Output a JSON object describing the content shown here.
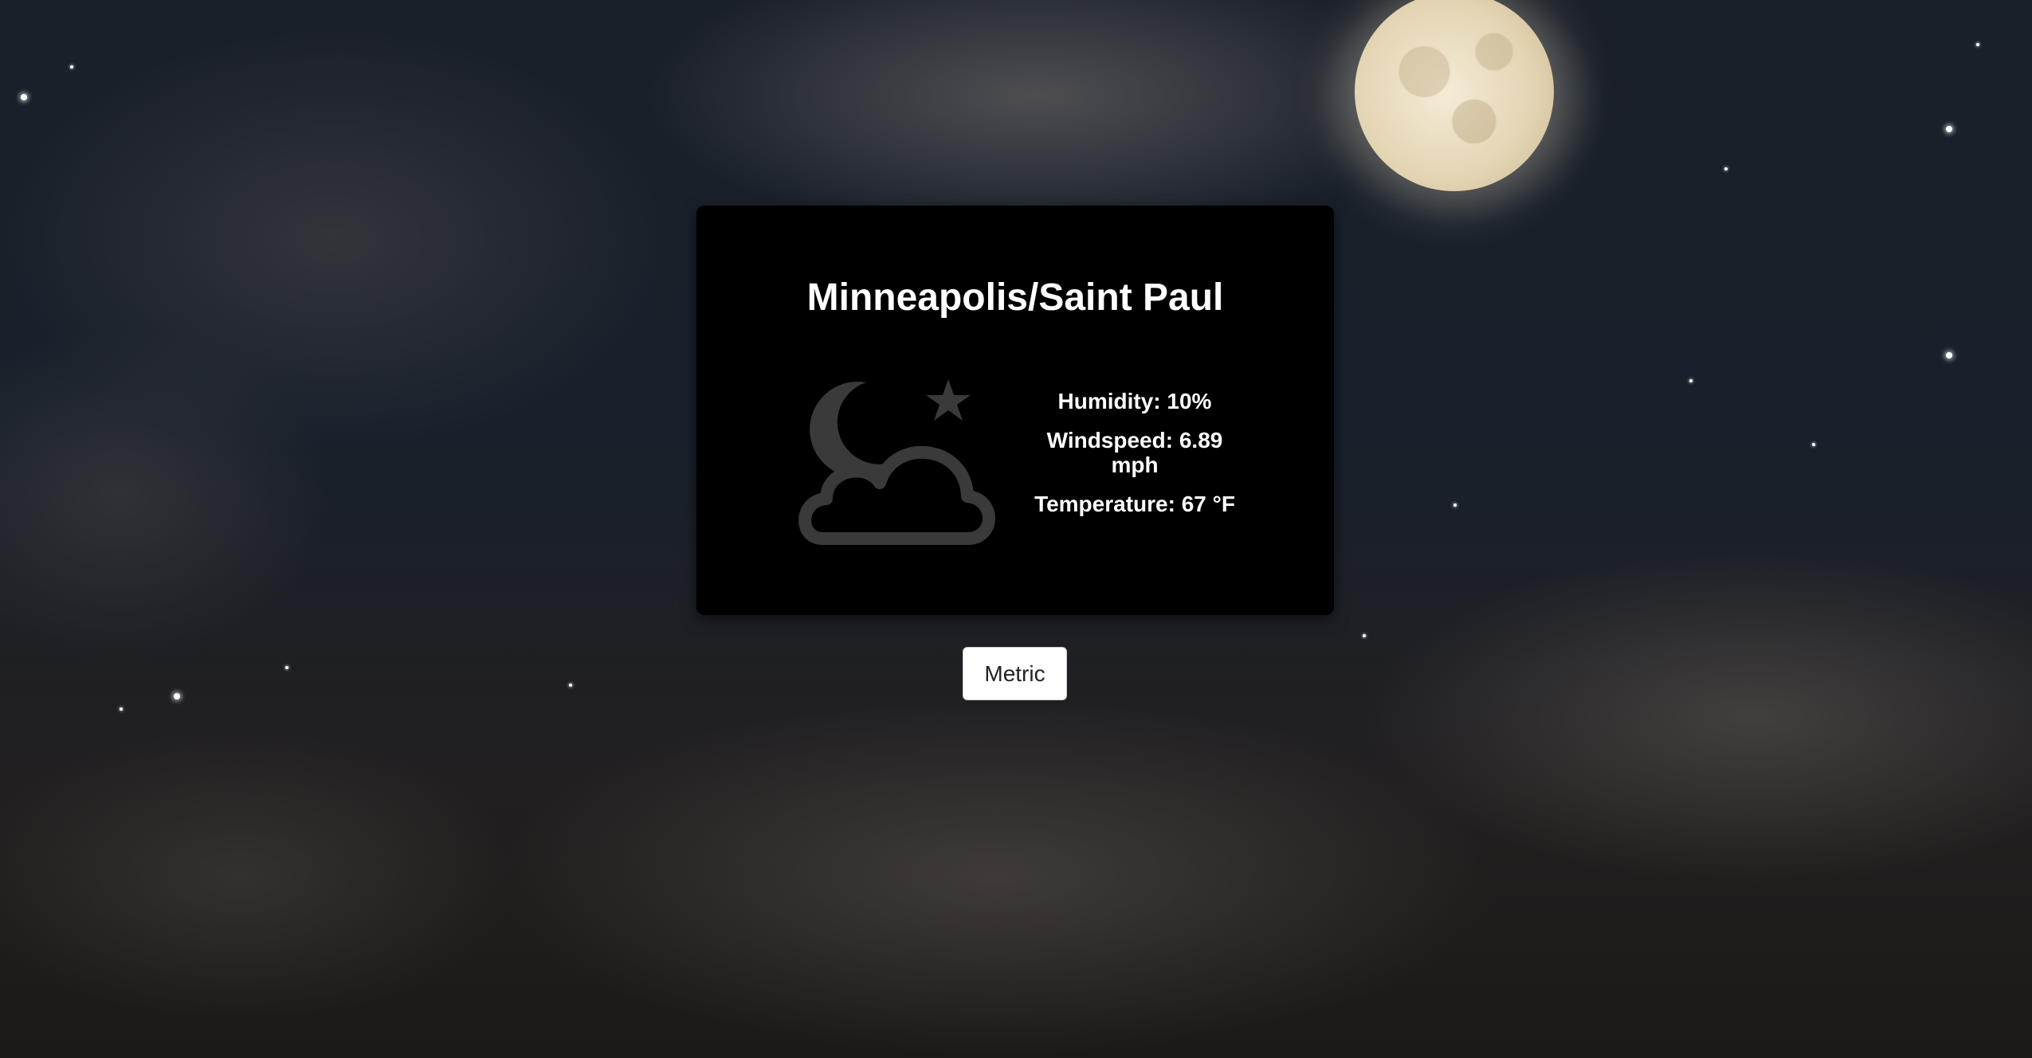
{
  "weather": {
    "city": "Minneapolis/Saint Paul",
    "icon": "partly-cloudy-night-icon",
    "humidity": "Humidity: 10%",
    "windspeed": "Windspeed: 6.89 mph",
    "temperature": "Temperature: 67 °F"
  },
  "controls": {
    "unit_toggle_label": "Metric"
  },
  "colors": {
    "card_background": "#000000",
    "text": "#ffffff",
    "icon": "#3a3a3a",
    "button_background": "#ffffff"
  }
}
